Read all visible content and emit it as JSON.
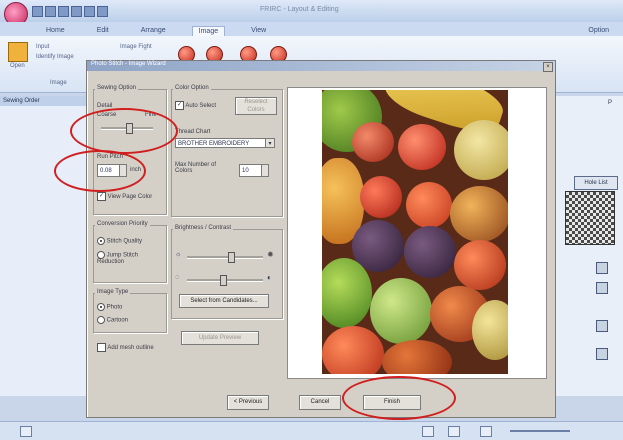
{
  "app": {
    "window_title": "FRIRC - Layout & Editing",
    "tabs": [
      "Home",
      "Edit",
      "Arrange",
      "Image",
      "View"
    ],
    "active_tab": "Image",
    "options_label": "Option",
    "ribbon": {
      "group_label": "Image",
      "open_label": "Open",
      "btn1": "Input",
      "btn2": "Identify Image",
      "btn3": "Image Fight"
    },
    "left_pane_title": "Sewing Order",
    "right_pane_label": "P",
    "hold_list": "Hole List"
  },
  "dialog": {
    "title": "Photo Stitch - Image Wizard",
    "sewing_option": {
      "label": "Sewing Option",
      "detail_label": "Detail",
      "coarse": "Coarse",
      "fine": "Fine",
      "detail_level": 0.55,
      "run_pitch_label": "Run Pitch",
      "run_pitch_value": "0.08",
      "unit": "inch",
      "view_page_color": "View Page Color"
    },
    "conversion_priority": {
      "label": "Conversion Priority",
      "options": [
        "Stitch Quality",
        "Jump Stitch Reduction"
      ],
      "selected": 0
    },
    "image_type": {
      "label": "Image Type",
      "options": [
        "Photo",
        "Cartoon"
      ],
      "selected": 0
    },
    "add_mesh_outline": "Add mesh outline",
    "color_option": {
      "label": "Color Option",
      "auto_select": "Auto Select",
      "reselect_btn": "Reselect Colors",
      "thread_chart_label": "Thread Chart",
      "thread_chart_value": "BROTHER EMBROIDERY",
      "max_colors_label": "Max Number of Colors",
      "max_colors_value": "10"
    },
    "brightness_contrast": {
      "label": "Brightness / Contrast",
      "brightness_level": 0.6,
      "contrast_level": 0.48,
      "select_candidates_btn": "Select from Candidates...",
      "update_preview_btn": "Update Preview"
    },
    "buttons": {
      "previous": "< Previous",
      "cancel": "Cancel",
      "finish": "Finish"
    }
  },
  "colors": {
    "annotation_ring": "#d11e1e",
    "dialog_bg": "#d4d0c8",
    "ribbon_bg": "#dfe9f8"
  }
}
